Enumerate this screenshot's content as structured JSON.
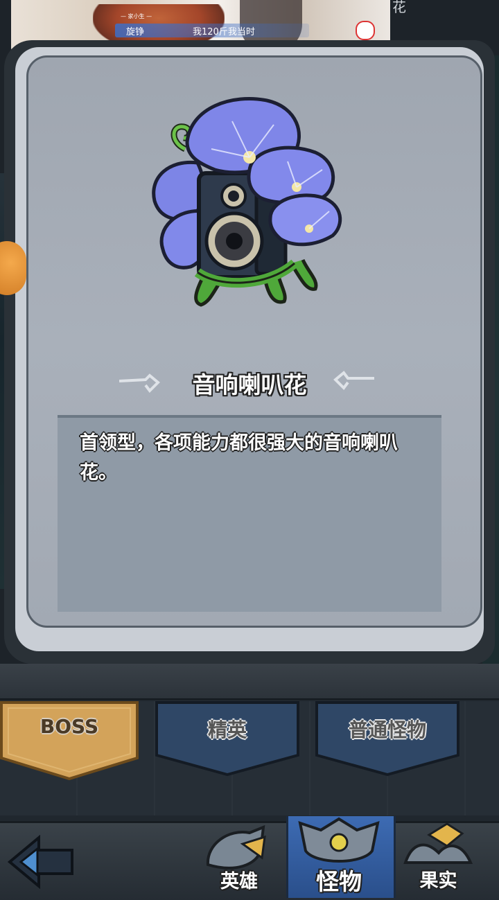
{
  "ad": {
    "name": "旋铮",
    "caption": "我120斤我当时",
    "tag": "— 家小生 —"
  },
  "background": {
    "title_fragment": "花"
  },
  "monster": {
    "name": "音响喇叭花",
    "description": "首领型，各项能力都很强大的音响喇叭花。",
    "art_icon": "speaker-morning-glory-icon"
  },
  "category_tabs": [
    {
      "label": "BOSS",
      "selected": true
    },
    {
      "label": "精英",
      "selected": false
    },
    {
      "label": "普通怪物",
      "selected": false
    }
  ],
  "bottom_nav": {
    "back_icon": "back-arrow-icon",
    "items": [
      {
        "label": "英雄",
        "icon": "hero-helmet-icon",
        "selected": false
      },
      {
        "label": "怪物",
        "icon": "monster-mask-icon",
        "selected": true
      },
      {
        "label": "果实",
        "icon": "fruit-plant-icon",
        "selected": false
      }
    ]
  },
  "colors": {
    "selected_tab": "#d3a35a",
    "unselected_tab": "#2f4766",
    "selected_nav": "#3d6bb3",
    "flower": "#7f86e8"
  }
}
